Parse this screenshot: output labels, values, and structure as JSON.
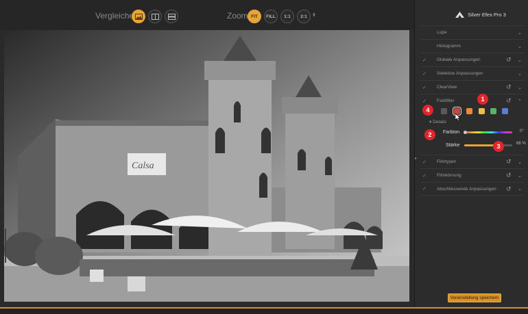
{
  "toolbar": {
    "compare_label": "Vergleichen",
    "zoom_label": "Zoom",
    "zoom_options": [
      "FIT",
      "FILL",
      "1:1",
      "2:1"
    ],
    "zoom_selected": "FIT",
    "accent_color": "#e8a437"
  },
  "photo": {
    "banner_text": "Calsa",
    "description_icon": "photo-canvas"
  },
  "panel": {
    "brand": "Silver Efex Pro 3",
    "sections": {
      "lupe": "Lupe",
      "histogramm": "Histogramm",
      "globale": "Globale Anpassungen",
      "selektive": "Selektive Anpassungen",
      "clearview": "ClearView",
      "farbfilter": "Farbfilter",
      "filmtypen": "Filmtypen",
      "filmkoernung": "Filmkörnung",
      "abschliessende": "Abschliessende Anpassungen"
    },
    "swatches": [
      "#5a5a5a",
      "#c9463f",
      "#e88a3c",
      "#e6c04a",
      "#57b368",
      "#5a7dd0"
    ],
    "details_label": "Details",
    "farbton": {
      "label": "Farbton",
      "value": "0",
      "unit": "°",
      "level": 0
    },
    "staerke": {
      "label": "Stärke",
      "value": "66",
      "unit": "%",
      "level": 0.66
    },
    "badges": [
      "1",
      "2",
      "3",
      "4"
    ],
    "save_button": "Voreinstellung speichern"
  }
}
